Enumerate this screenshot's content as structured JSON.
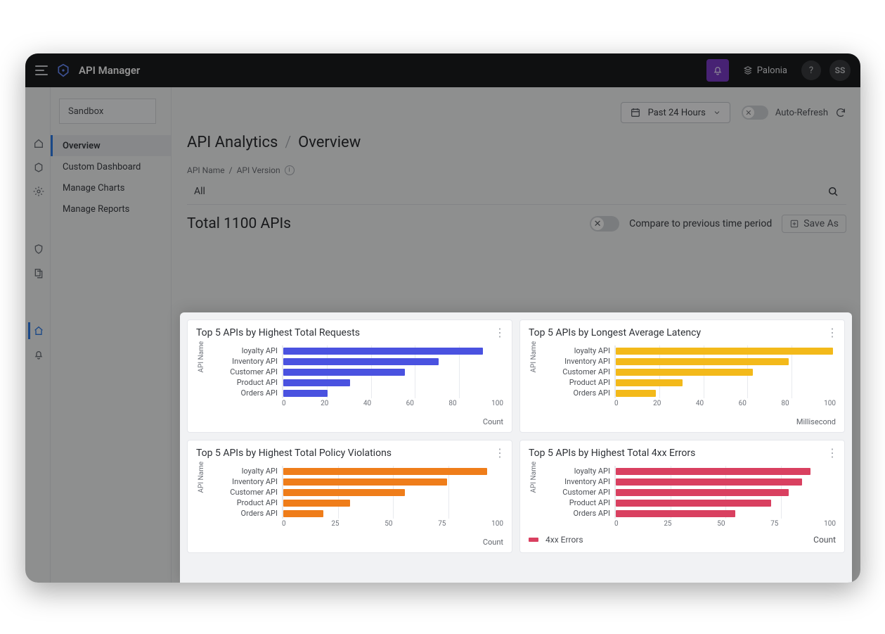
{
  "header": {
    "app_title": "API Manager",
    "org_name": "Palonia",
    "avatar_initials": "SS",
    "help_label": "?"
  },
  "sidebar": {
    "environment": "Sandbox",
    "items": [
      {
        "label": "Overview",
        "active": true
      },
      {
        "label": "Custom Dashboard",
        "active": false
      },
      {
        "label": "Manage Charts",
        "active": false
      },
      {
        "label": "Manage Reports",
        "active": false
      }
    ]
  },
  "toolbar": {
    "time_range": "Past 24 Hours",
    "auto_refresh_label": "Auto-Refresh"
  },
  "breadcrumb": {
    "root": "API Analytics",
    "current": "Overview"
  },
  "filter": {
    "label_a": "API Name",
    "label_b": "API Version",
    "value": "All"
  },
  "summary": {
    "total_label": "Total 1100 APIs",
    "compare_label": "Compare to previous time period",
    "save_as_label": "Save As"
  },
  "cards": {
    "requests": {
      "title": "Top 5 APIs by Highest Total Requests",
      "ylabel": "API Name",
      "xunit": "Count"
    },
    "latency": {
      "title": "Top 5 APIs by Longest Average Latency",
      "ylabel": "API Name",
      "xunit": "Millisecond"
    },
    "violations": {
      "title": "Top 5 APIs by Highest Total Policy Violations",
      "ylabel": "API Name",
      "xunit": "Count"
    },
    "errors4xx": {
      "title": "Top 5 APIs by Highest Total 4xx Errors",
      "ylabel": "API Name",
      "xunit": "Count",
      "legend": "4xx Errors"
    }
  },
  "chart_data": [
    {
      "id": "requests",
      "type": "bar",
      "orientation": "horizontal",
      "title": "Top 5 APIs by Highest Total Requests",
      "ylabel": "API Name",
      "xlabel": "Count",
      "xlim": [
        0,
        100
      ],
      "xticks": [
        0,
        20,
        40,
        60,
        80,
        100
      ],
      "categories": [
        "loyalty API",
        "Inventory API",
        "Customer API",
        "Product API",
        "Orders API"
      ],
      "values": [
        90,
        70,
        55,
        30,
        20
      ],
      "color": "#4a52e0"
    },
    {
      "id": "latency",
      "type": "bar",
      "orientation": "horizontal",
      "title": "Top 5 APIs by Longest Average Latency",
      "ylabel": "API Name",
      "xlabel": "Millisecond",
      "xlim": [
        0,
        100
      ],
      "xticks": [
        0,
        20,
        40,
        60,
        80,
        100
      ],
      "categories": [
        "loyalty API",
        "Inventory API",
        "Customer API",
        "Product API",
        "Orders API"
      ],
      "values": [
        98,
        78,
        62,
        30,
        18
      ],
      "color": "#f3b91a"
    },
    {
      "id": "violations",
      "type": "bar",
      "orientation": "horizontal",
      "title": "Top 5 APIs by Highest Total Policy Violations",
      "ylabel": "API Name",
      "xlabel": "Count",
      "xlim": [
        0,
        100
      ],
      "xticks": [
        0,
        25,
        50,
        75,
        100
      ],
      "categories": [
        "loyalty API",
        "Inventory API",
        "Customer API",
        "Product API",
        "Orders API"
      ],
      "values": [
        92,
        74,
        55,
        30,
        18
      ],
      "color": "#ef7d1a"
    },
    {
      "id": "errors4xx",
      "type": "bar",
      "orientation": "horizontal",
      "title": "Top 5 APIs by Highest Total 4xx Errors",
      "ylabel": "API Name",
      "xlabel": "Count",
      "xlim": [
        0,
        100
      ],
      "xticks": [
        0,
        25,
        50,
        75,
        100
      ],
      "categories": [
        "loyalty API",
        "Inventory API",
        "Customer API",
        "Product API",
        "Orders API"
      ],
      "values": [
        88,
        84,
        78,
        70,
        54
      ],
      "color": "#d94060",
      "legend": "4xx Errors"
    }
  ],
  "peek": {
    "categories": [
      "loyalty API",
      "Inventory API"
    ],
    "values": [
      90,
      78
    ],
    "color": "#8a1c2a"
  }
}
